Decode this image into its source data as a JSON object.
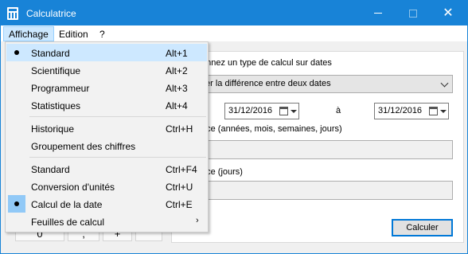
{
  "window": {
    "title": "Calculatrice"
  },
  "menubar": {
    "items": [
      {
        "label": "Affichage"
      },
      {
        "label": "Edition"
      },
      {
        "label": "?"
      }
    ]
  },
  "dropdown": {
    "group1": [
      {
        "label": "Standard",
        "shortcut": "Alt+1",
        "checked": true
      },
      {
        "label": "Scientifique",
        "shortcut": "Alt+2"
      },
      {
        "label": "Programmeur",
        "shortcut": "Alt+3"
      },
      {
        "label": "Statistiques",
        "shortcut": "Alt+4"
      }
    ],
    "group2": [
      {
        "label": "Historique",
        "shortcut": "Ctrl+H"
      },
      {
        "label": "Groupement des chiffres",
        "shortcut": ""
      }
    ],
    "group3": [
      {
        "label": "Standard",
        "shortcut": "Ctrl+F4"
      },
      {
        "label": "Conversion d'unités",
        "shortcut": "Ctrl+U"
      },
      {
        "label": "Calcul de la date",
        "shortcut": "Ctrl+E",
        "checked": true
      },
      {
        "label": "Feuilles de calcul",
        "shortcut": "",
        "submenu_icon": "chevron-right-icon"
      }
    ]
  },
  "date_panel": {
    "select_label_partial": "onnez un type de calcul sur dates",
    "select_value_partial": "er la différence entre deux dates",
    "from_date": "31/12/2016",
    "to_label": "à",
    "to_date": "31/12/2016",
    "result1_label_partial": "nce (années, mois, semaines, jours)",
    "result2_label_partial": "nce (jours)",
    "calculate_button": "Calculer"
  },
  "keypad": {
    "visible_keys": [
      "0",
      ",",
      "+",
      ""
    ]
  },
  "colors": {
    "titlebar": "#1883d7",
    "menu_highlight": "#cce8ff",
    "accent_border": "#0078d7"
  }
}
